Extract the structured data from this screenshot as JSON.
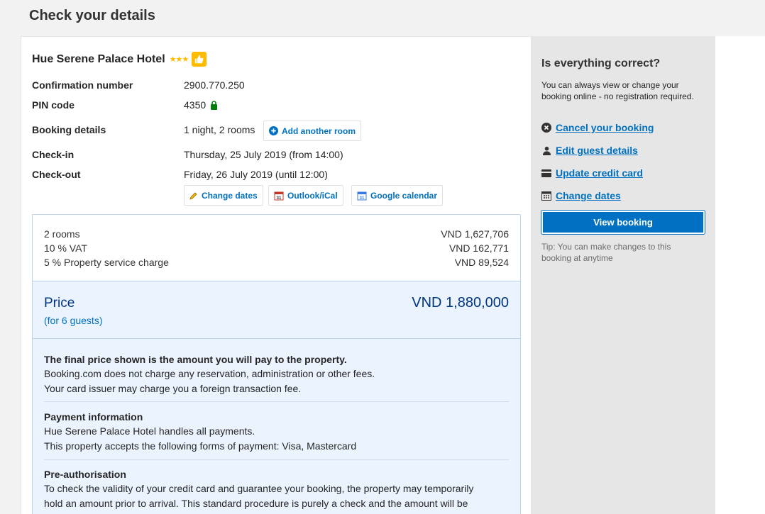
{
  "page_title": "Check your details",
  "hotel": {
    "name": "Hue Serene Palace Hotel",
    "stars": "★★★"
  },
  "details": {
    "confirmation_label": "Confirmation number",
    "confirmation_value": "2900.770.250",
    "pin_label": "PIN code",
    "pin_value": "4350",
    "booking_label": "Booking details",
    "booking_value": "1 night, 2 rooms",
    "add_room_label": "Add another room",
    "checkin_label": "Check-in",
    "checkin_value": "Thursday, 25 July 2019 (from 14:00)",
    "checkout_label": "Check-out",
    "checkout_value": "Friday, 26 July 2019 (until 12:00)",
    "change_dates_label": "Change dates",
    "outlook_label": "Outlook/iCal",
    "gcal_label": "Google calendar"
  },
  "fees": [
    {
      "label": "2 rooms",
      "amount": "VND 1,627,706"
    },
    {
      "label": "10 % VAT",
      "amount": "VND 162,771"
    },
    {
      "label": "5 % Property service charge",
      "amount": "VND 89,524"
    }
  ],
  "price": {
    "label": "Price",
    "guests": "(for 6 guests)",
    "total": "VND 1,880,000"
  },
  "info": {
    "final_title": "The final price shown is the amount you will pay to the property.",
    "final_line1": "Booking.com does not charge any reservation, administration or other fees.",
    "final_line2": "Your card issuer may charge you a foreign transaction fee.",
    "payment_title": "Payment information",
    "payment_line1": "Hue Serene Palace Hotel handles all payments.",
    "payment_line2": "This property accepts the following forms of payment: Visa, Mastercard",
    "preauth_title": "Pre-authorisation",
    "preauth_line1": "To check the validity of your credit card and guarantee your booking, the property may temporarily",
    "preauth_line2": "hold an amount prior to arrival. This standard procedure is purely a check and the amount will be"
  },
  "side": {
    "title": "Is everything correct?",
    "description": "You can always view or change your booking online - no registration required.",
    "links": [
      "Cancel your booking",
      "Edit guest details",
      "Update credit card",
      "Change dates"
    ],
    "view_button": "View booking",
    "tip": "Tip: You can make changes to this booking at anytime"
  },
  "colors": {
    "brand_blue": "#0071c2",
    "dark_blue": "#003580",
    "star_yellow": "#febb02",
    "lock_green": "#008009"
  }
}
